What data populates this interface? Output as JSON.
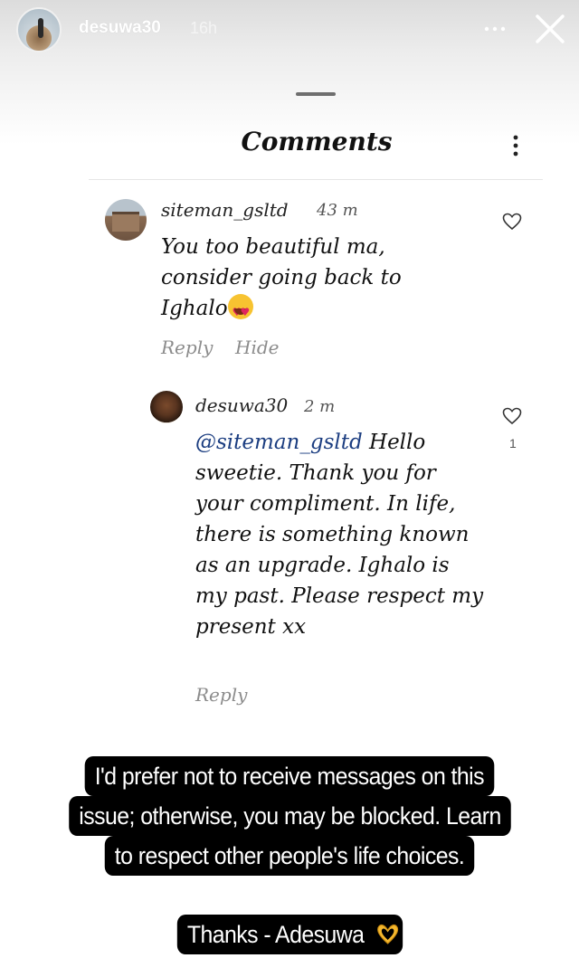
{
  "story": {
    "username": "desuwa30",
    "time_ago": "16h"
  },
  "sheet": {
    "title": "Comments"
  },
  "comment": {
    "username": "siteman_gsltd",
    "time_ago": "43 m",
    "text_line1": "You too beautiful ma,",
    "text_line2": "consider going back to",
    "text_line3": "Ighalo",
    "reply_label": "Reply",
    "hide_label": "Hide"
  },
  "reply": {
    "username": "desuwa30",
    "time_ago": "2 m",
    "mention": "@siteman_gsltd",
    "text_after_mention": " Hello sweetie. Thank you for your compliment. In life, there is something known as an upgrade. Ighalo is my past. Please respect my present xx",
    "reply_label": "Reply",
    "like_count": "1"
  },
  "captions": {
    "line1": "I'd prefer not to receive messages on this",
    "line2": "issue; otherwise, you may be blocked. Learn",
    "line3": "to respect other people's life choices.",
    "line4": "Thanks - Adesuwa"
  },
  "icons": {
    "close": "close-icon",
    "more": "more-icon",
    "heart": "heart-icon",
    "emoji": "heart-eyes-emoji",
    "hands": "heart-hands-emoji"
  }
}
